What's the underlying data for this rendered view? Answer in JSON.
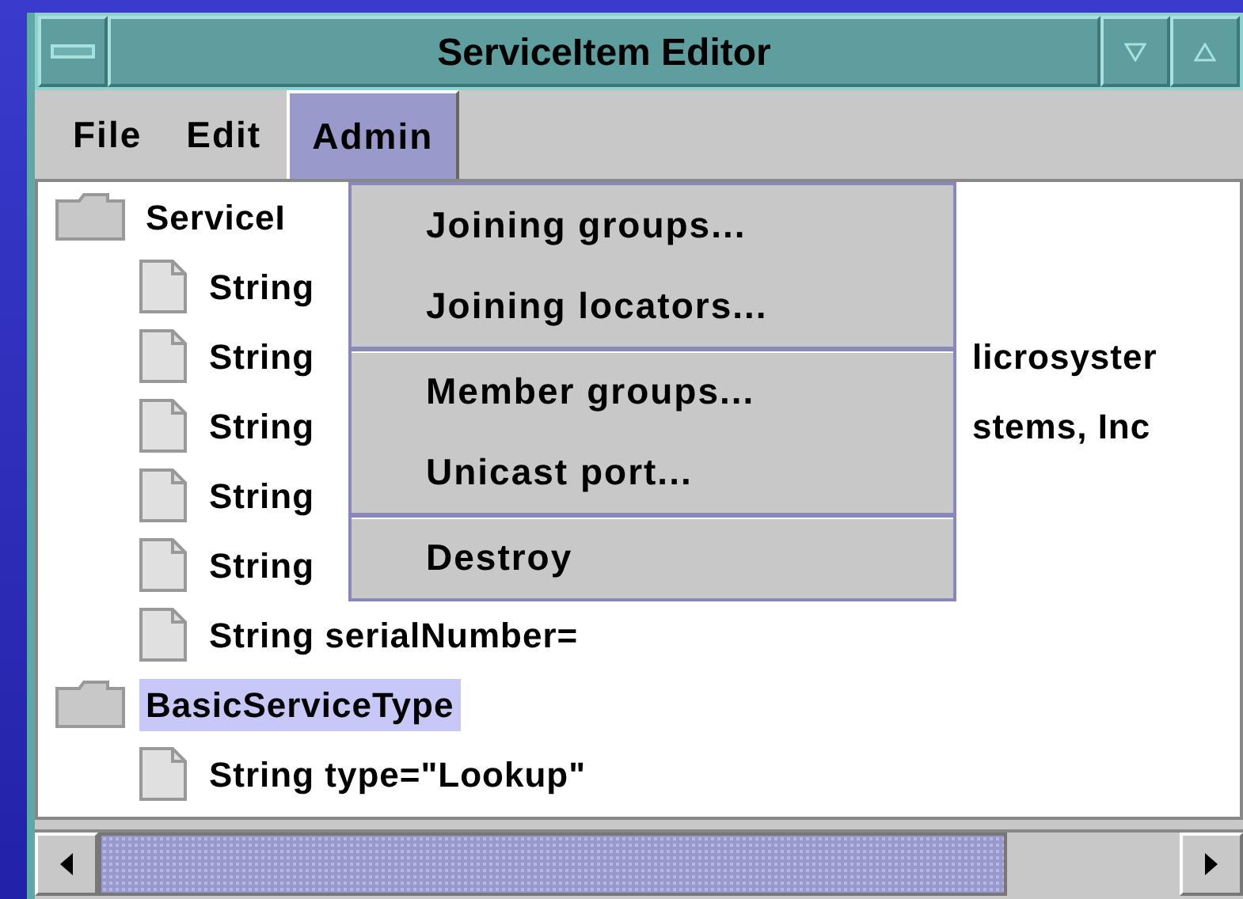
{
  "window": {
    "title": "ServiceItem Editor"
  },
  "menubar": [
    {
      "label": "File",
      "selected": false
    },
    {
      "label": "Edit",
      "selected": false
    },
    {
      "label": "Admin",
      "selected": true
    }
  ],
  "dropdown": {
    "groups": [
      [
        {
          "label": "Joining groups..."
        },
        {
          "label": "Joining locators..."
        }
      ],
      [
        {
          "label": "Member groups..."
        },
        {
          "label": "Unicast port..."
        }
      ],
      [
        {
          "label": "Destroy"
        }
      ]
    ]
  },
  "tree": [
    {
      "kind": "folder",
      "text": "ServiceI",
      "selected": false,
      "children": [
        {
          "kind": "leaf",
          "text": "String",
          "selected": false
        },
        {
          "kind": "leaf",
          "text": "String",
          "text_right": "licrosyster",
          "selected": false
        },
        {
          "kind": "leaf",
          "text": "String",
          "text_right": "stems, Inc",
          "selected": false
        },
        {
          "kind": "leaf",
          "text": "String",
          "selected": false
        },
        {
          "kind": "leaf",
          "text": "String",
          "selected": false
        },
        {
          "kind": "leaf",
          "text": "String serialNumber=",
          "selected": false
        }
      ]
    },
    {
      "kind": "folder",
      "text": "BasicServiceType",
      "selected": true,
      "children": [
        {
          "kind": "leaf",
          "text": "String type=\"Lookup\"",
          "selected": false
        }
      ]
    }
  ]
}
